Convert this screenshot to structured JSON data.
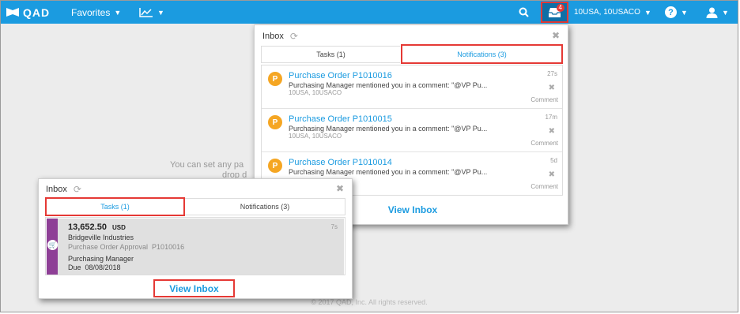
{
  "topbar": {
    "logo": "QAD",
    "favorites": "Favorites",
    "notification_count": "4",
    "domain": "10USA, 10USACO"
  },
  "background": {
    "hint_line1": "You can set any pa",
    "hint_line2": "drop d",
    "footer": "© 2017 QAD, Inc. All rights reserved."
  },
  "inbox_notifications": {
    "title": "Inbox",
    "tabs": [
      {
        "label": "Tasks (1)"
      },
      {
        "label": "Notifications (3)"
      }
    ],
    "items": [
      {
        "avatar": "P",
        "title": "Purchase Order P1010016",
        "message": "Purchasing Manager mentioned you in a comment: \"@VP Pu...",
        "sub": "10USA, 10USACO",
        "time": "27s",
        "action": "Comment"
      },
      {
        "avatar": "P",
        "title": "Purchase Order P1010015",
        "message": "Purchasing Manager mentioned you in a comment: \"@VP Pu...",
        "sub": "10USA, 10USACO",
        "time": "17m",
        "action": "Comment"
      },
      {
        "avatar": "P",
        "title": "Purchase Order P1010014",
        "message": "Purchasing Manager mentioned you in a comment: \"@VP Pu...",
        "sub": "",
        "time": "5d",
        "action": "Comment"
      }
    ],
    "view_inbox": "View Inbox"
  },
  "inbox_tasks": {
    "title": "Inbox",
    "tabs": [
      {
        "label": "Tasks (1)"
      },
      {
        "label": "Notifications (3)"
      }
    ],
    "task": {
      "amount": "13,652.50",
      "currency": "USD",
      "company": "Bridgeville Industries",
      "description": "Purchase Order Approval  P1010016",
      "role": "Purchasing Manager",
      "due": "Due  08/08/2018",
      "time": "7s"
    },
    "view_inbox": "View Inbox"
  },
  "colors": {
    "accent": "#1b9be0",
    "highlight": "#e53935",
    "task_bar": "#8e3f96",
    "avatar": "#f5a623"
  }
}
